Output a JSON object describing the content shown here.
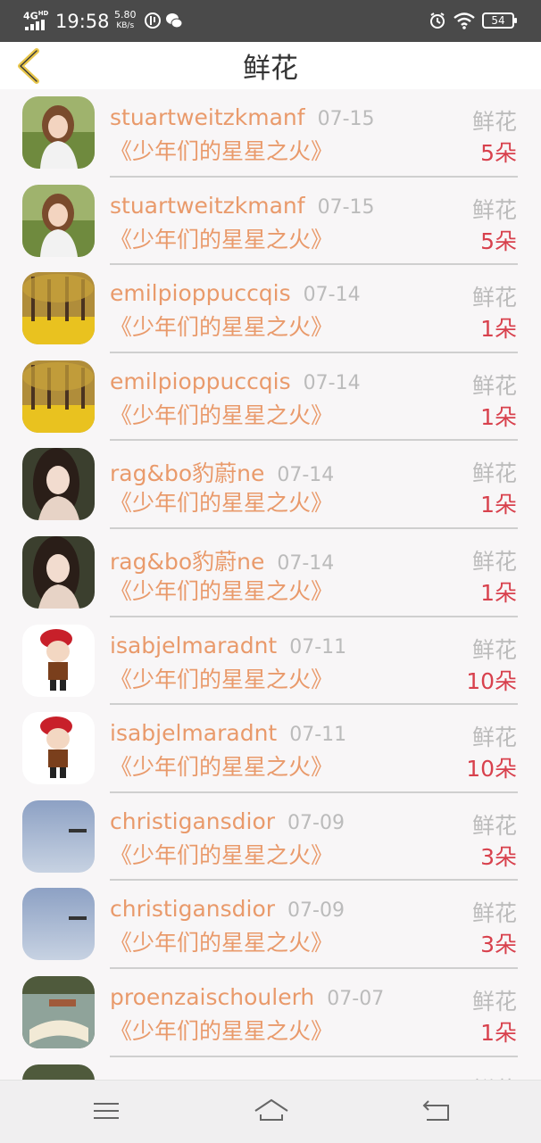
{
  "status_bar": {
    "network": "4G",
    "network_sup": "HD",
    "time": "19:58",
    "speed_value": "5.80",
    "speed_unit": "KB/s",
    "battery": "54"
  },
  "header": {
    "title": "鲜花"
  },
  "records": [
    {
      "name": "stuartweitzkmanf",
      "date": "07-15",
      "book": "《少年们的星星之火》",
      "gift": "鲜花",
      "count": "5朵",
      "avatar": "girl-white"
    },
    {
      "name": "stuartweitzkmanf",
      "date": "07-15",
      "book": "《少年们的星星之火》",
      "gift": "鲜花",
      "count": "5朵",
      "avatar": "girl-white"
    },
    {
      "name": "emilpioppuccqis",
      "date": "07-14",
      "book": "《少年们的星星之火》",
      "gift": "鲜花",
      "count": "1朵",
      "avatar": "autumn-trees"
    },
    {
      "name": "emilpioppuccqis",
      "date": "07-14",
      "book": "《少年们的星星之火》",
      "gift": "鲜花",
      "count": "1朵",
      "avatar": "autumn-trees"
    },
    {
      "name": "rag&bo豹蔚ne",
      "date": "07-14",
      "book": "《少年们的星星之火》",
      "gift": "鲜花",
      "count": "1朵",
      "avatar": "girl-dark"
    },
    {
      "name": "rag&bo豹蔚ne",
      "date": "07-14",
      "book": "《少年们的星星之火》",
      "gift": "鲜花",
      "count": "1朵",
      "avatar": "girl-dark"
    },
    {
      "name": "isabjelmaradnt",
      "date": "07-11",
      "book": "《少年们的星星之火》",
      "gift": "鲜花",
      "count": "10朵",
      "avatar": "cartoon-boy"
    },
    {
      "name": "isabjelmaradnt",
      "date": "07-11",
      "book": "《少年们的星星之火》",
      "gift": "鲜花",
      "count": "10朵",
      "avatar": "cartoon-boy"
    },
    {
      "name": "christigansdior",
      "date": "07-09",
      "book": "《少年们的星星之火》",
      "gift": "鲜花",
      "count": "3朵",
      "avatar": "blue-sky"
    },
    {
      "name": "christigansdior",
      "date": "07-09",
      "book": "《少年们的星星之火》",
      "gift": "鲜花",
      "count": "3朵",
      "avatar": "blue-sky"
    },
    {
      "name": "proenzaischoulerh",
      "date": "07-07",
      "book": "《少年们的星星之火》",
      "gift": "鲜花",
      "count": "1朵",
      "avatar": "open-book"
    },
    {
      "name": "",
      "date": "",
      "book": "",
      "gift": "鲜花",
      "count": "",
      "avatar": "open-book"
    }
  ],
  "nav": {
    "menu_icon": "menu-icon",
    "home_icon": "home-icon",
    "back_icon": "back-icon"
  },
  "colors": {
    "accent_orange": "#e99a6b",
    "count_red": "#d8414d",
    "back_yellow": "#e8c64a"
  }
}
